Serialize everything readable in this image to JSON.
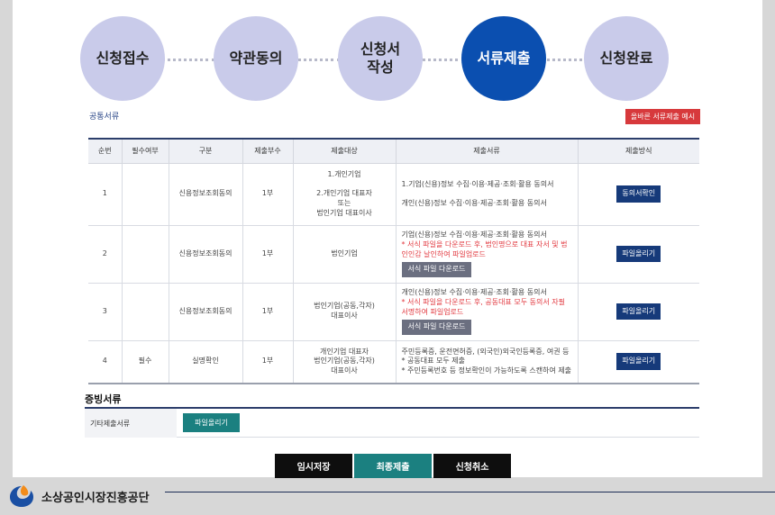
{
  "steps": [
    {
      "label": "신청접수"
    },
    {
      "label": "약관동의"
    },
    {
      "label": "신청서\n작성"
    },
    {
      "label": "서류제출"
    },
    {
      "label": "신청완료"
    }
  ],
  "common_docs": {
    "title": "공통서류",
    "example_button": "올바른 서류제출 예시"
  },
  "table": {
    "headers": [
      "순번",
      "필수여부",
      "구분",
      "제출부수",
      "제출대상",
      "제출서류",
      "제출방식"
    ],
    "rows": [
      {
        "no": "1",
        "required": "",
        "category": "신용정보조회동의",
        "copies": "1부",
        "target": "1.개인기업\n\n2.개인기업 대표자\n또는\n법인기업 대표이사",
        "doc1": "1.기업(신용)정보 수집·이용·제공·조회·활용 동의서",
        "doc2": "개인(신용)정보 수집·이용·제공·조회·활용 동의서",
        "method": "동의서확인"
      },
      {
        "no": "2",
        "required": "",
        "category": "신용정보조회동의",
        "copies": "1부",
        "target": "법인기업",
        "doc1": "기업(신용)정보 수집·이용·제공·조회·활용 동의서",
        "note": "* 서식 파일을 다운로드 후, 법인명으로 대표 자서 및 법인인감 날인하여 파일업로드",
        "download": "서식 파일 다운로드",
        "method": "파일올리기"
      },
      {
        "no": "3",
        "required": "",
        "category": "신용정보조회동의",
        "copies": "1부",
        "target": "법인기업(공동,각자)\n대표이사",
        "doc1": "개인(신용)정보 수집·이용·제공·조회·활용 동의서",
        "note": "* 서식 파일을 다운로드 후, 공동대표 모두 동의서 자필 서명하여 파일업로드",
        "download": "서식 파일 다운로드",
        "method": "파일올리기"
      },
      {
        "no": "4",
        "required": "필수",
        "category": "실명확인",
        "copies": "1부",
        "target": "개인기업 대표자\n법인기업(공동,각자)\n대표이사",
        "doc1": "주민등록증, 운전면허증, (외국인)외국인등록증, 여권 등",
        "note1": "* 공동대표 모두 제출",
        "note2": "* 주민등록번호 등 정보확인이 가능하도록 스캔하여 제출",
        "method": "파일올리기"
      }
    ]
  },
  "evidence": {
    "title": "증빙서류",
    "label": "기타제출서류",
    "upload": "파일올리기"
  },
  "actions": {
    "save": "임시저장",
    "submit": "최종제출",
    "cancel": "신청취소"
  },
  "footer": {
    "org_name": "소상공인시장진흥공단"
  },
  "colors": {
    "active_step": "#0b4fb0",
    "inactive_step": "#c9cbea",
    "button_navy": "#163a7a",
    "button_teal": "#1b8080",
    "button_red": "#d7393c"
  }
}
